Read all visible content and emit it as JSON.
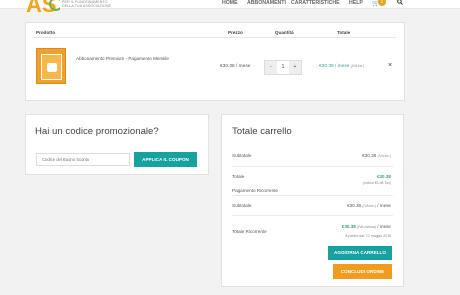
{
  "header": {
    "logo_letters": "AS",
    "logo_tagline_1": "PER IL FUNZIONAMENTO",
    "logo_tagline_2": "DELLA TUA ASSOCIAZIONE",
    "nav": [
      "HOME",
      "ABBONAMENTI",
      "CARATTERISTICHE",
      "HELP"
    ],
    "cart_count": "1",
    "colors": {
      "accent": "#e8a317"
    }
  },
  "cart_table": {
    "headers": {
      "product": "Prodotto",
      "price": "Prezzo",
      "quantity": "Quantità",
      "total": "Totale"
    },
    "item": {
      "name": "Abbonamento Premium - Pagamento Mensile",
      "price": "€30.38 / mese",
      "quantity": "1",
      "minus": "-",
      "plus": "+",
      "subtotal": "€30.38 / mese",
      "subtotal_note": "(IVA inc.)",
      "remove": "×"
    }
  },
  "coupon": {
    "title": "Hai un codice promozionale?",
    "placeholder": "Codice del Buono Sconto",
    "button": "APPLICA IL COUPON"
  },
  "totals": {
    "title": "Totale carrello",
    "subtotal_label": "Subtotale",
    "subtotal_value": "€30.38",
    "subtotal_note": "(IVA inc.)",
    "total_label": "Totale",
    "total_value": "€30.38",
    "total_note": "(inclusi €5.48 Tax)",
    "recurring_heading": "Pagamento Ricorrente",
    "recurring_subtotal_label": "Subtotale",
    "recurring_subtotal_value": "€30.38",
    "recurring_subtotal_note": "(IVA inc.)",
    "recurring_subtotal_period": "/ mese",
    "recurring_total_label": "Totale Ricorrente",
    "recurring_total_value": "€30.38",
    "recurring_total_note": "(IVA inclusa)",
    "recurring_total_period": "/ mese",
    "recurring_start": "A partire dal: 12 maggio 2018",
    "update_button": "AGGIORNA CARRELLO",
    "checkout_button": "CONCLUDI ORDINE"
  }
}
